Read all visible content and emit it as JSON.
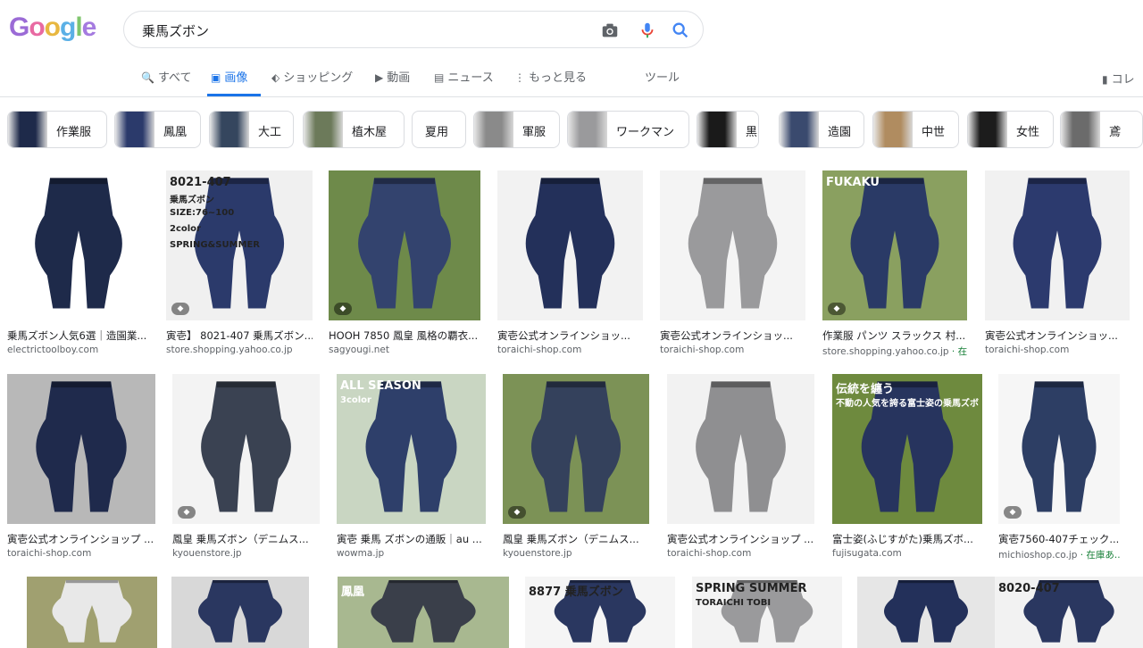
{
  "logo": {
    "letters": [
      "G",
      "o",
      "o",
      "g",
      "l",
      "e"
    ],
    "colors": [
      "#9b6bd6",
      "#e86aa2",
      "#e8b740",
      "#5bb0e6",
      "#7fc66d",
      "#a57be0"
    ]
  },
  "search": {
    "query": "乗馬ズボン"
  },
  "tabs": [
    {
      "label": "すべて",
      "icon": "search-icon"
    },
    {
      "label": "画像",
      "icon": "image-icon",
      "active": true
    },
    {
      "label": "ショッピング",
      "icon": "tag-icon"
    },
    {
      "label": "動画",
      "icon": "play-icon"
    },
    {
      "label": "ニュース",
      "icon": "news-icon"
    },
    {
      "label": "もっと見る",
      "icon": "more-dots-icon"
    },
    {
      "label": "ツール",
      "icon": ""
    }
  ],
  "collections": {
    "label": "コレ"
  },
  "chips": [
    {
      "label": "作業服"
    },
    {
      "label": "鳳凰"
    },
    {
      "label": "大工"
    },
    {
      "label": "植木屋"
    },
    {
      "label": "夏用"
    },
    {
      "label": "軍服"
    },
    {
      "label": "ワークマン"
    },
    {
      "label": "黒"
    },
    {
      "label": "造園"
    },
    {
      "label": "中世"
    },
    {
      "label": "女性"
    },
    {
      "label": "鳶"
    }
  ],
  "results": [
    {
      "caption": "乗馬ズボン人気6選｜造園業...",
      "source": "electrictoolboy.com",
      "color": "#1e2a4a",
      "bg": "#ffffff"
    },
    {
      "caption": "寅壱】 8021-407 乗馬ズボン...",
      "source": "store.shopping.yahoo.co.jp",
      "color": "#2b3a6b",
      "bg": "#f0f0f0",
      "overlay": [
        "8021-407",
        "乗馬ズボン",
        "SIZE:76~100",
        "2color",
        "SPRING&SUMMER"
      ],
      "tag": true
    },
    {
      "caption": "HOOH 7850 鳳皇 風格の覇衣...",
      "source": "sagyougi.net",
      "color": "#33436e",
      "bg": "#6e8a4a",
      "tag": true
    },
    {
      "caption": "寅壱公式オンラインショッ...",
      "source": "toraichi-shop.com",
      "color": "#23305a",
      "bg": "#f2f2f2"
    },
    {
      "caption": "寅壱公式オンラインショッ...",
      "source": "toraichi-shop.com",
      "color": "#9a9a9c",
      "bg": "#f4f4f4"
    },
    {
      "caption": "作業服 パンツ スラックス 村...",
      "source": "store.shopping.yahoo.co.jp",
      "extra": " · 在...",
      "color": "#2a3a66",
      "bg": "#8aa060",
      "overlay": [
        "FUKAKU"
      ],
      "tag": true
    },
    {
      "caption": "寅壱公式オンラインショッ...",
      "source": "toraichi-shop.com",
      "color": "#2c3a6e",
      "bg": "#f1f1f1"
    },
    {
      "caption": "寅壱公式オンラインショップ ...",
      "source": "toraichi-shop.com",
      "color": "#1f2a4c",
      "bg": "#b8b8b8"
    },
    {
      "caption": "鳳皇 乗馬ズボン（デニムス...",
      "source": "kyouenstore.jp",
      "color": "#3a4252",
      "bg": "#f3f3f3",
      "tag": true
    },
    {
      "caption": "寅壱 乗馬 ズボンの通販｜au ...",
      "source": "wowma.jp",
      "color": "#2e3f6a",
      "bg": "#c9d6c2",
      "overlay": [
        "ALL SEASON",
        "3color"
      ]
    },
    {
      "caption": "鳳皇 乗馬ズボン（デニムス...",
      "source": "kyouenstore.jp",
      "color": "#34415c",
      "bg": "#7c9256",
      "tag": true
    },
    {
      "caption": "寅壱公式オンラインショップ ...",
      "source": "toraichi-shop.com",
      "color": "#8f8f91",
      "bg": "#f2f2f2"
    },
    {
      "caption": "富士姿(ふじすがた)乗馬ズボ...",
      "source": "fujisugata.com",
      "color": "#27345e",
      "bg": "#6e8a3e",
      "overlay": [
        "伝統を纏う",
        "不動の人気を誇る富士姿の乗馬ズボン"
      ]
    },
    {
      "caption": "寅壱7560-407チェック...",
      "source": "michioshop.co.jp",
      "extra": " · 在庫あ...",
      "color": "#2d3e64",
      "bg": "#f6f6f6",
      "tag": true
    },
    {
      "caption": "",
      "source": "",
      "color": "#e8e8e8",
      "bg": "#a0a070"
    },
    {
      "caption": "",
      "source": "",
      "color": "#2a3760",
      "bg": "#d8d8d8"
    },
    {
      "caption": "",
      "source": "",
      "color": "#3a3f4a",
      "bg": "#a8b890",
      "overlay": [
        "鳳凰"
      ]
    },
    {
      "caption": "",
      "source": "",
      "color": "#2a3760",
      "bg": "#f5f5f5",
      "overlay": [
        "8877 乗馬ズボン"
      ]
    },
    {
      "caption": "",
      "source": "",
      "color": "#9a9a9c",
      "bg": "#f3f3f3",
      "overlay": [
        "SPRING SUMMER",
        "TORAICHI TOBI"
      ]
    },
    {
      "caption": "",
      "source": "",
      "color": "#23305a",
      "bg": "#e6e6e6"
    },
    {
      "caption": "",
      "source": "",
      "color": "#2a3760",
      "bg": "#f2f2f2",
      "overlay": [
        "8020-407"
      ]
    }
  ]
}
